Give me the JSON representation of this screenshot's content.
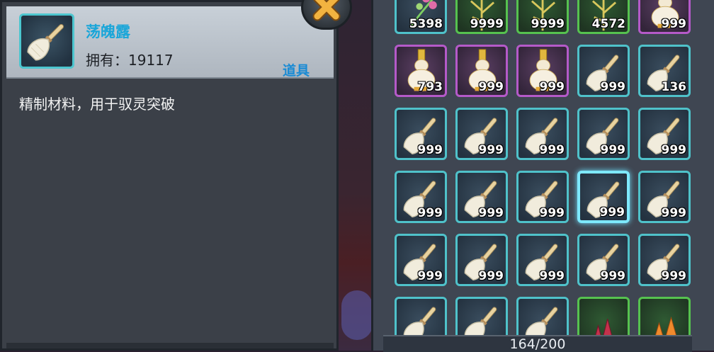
{
  "detail": {
    "name": "荡魄露",
    "owned_label": "拥有：",
    "owned_count": "19117",
    "type": "道具",
    "description": "精制材料，用于驭灵突破"
  },
  "bag": {
    "capacity": "164/200",
    "rows": [
      [
        {
          "kind": "herb-pink",
          "rarity": "teal",
          "qty": "5398"
        },
        {
          "kind": "herb-gold",
          "rarity": "green",
          "qty": "9999"
        },
        {
          "kind": "herb-gold",
          "rarity": "green",
          "qty": "9999"
        },
        {
          "kind": "herb-gold",
          "rarity": "green",
          "qty": "4572"
        },
        {
          "kind": "gourd-vase",
          "rarity": "purple",
          "qty": "999"
        }
      ],
      [
        {
          "kind": "gourd-vase",
          "rarity": "purple",
          "qty": "793"
        },
        {
          "kind": "gourd-vase",
          "rarity": "purple",
          "qty": "999"
        },
        {
          "kind": "gourd-vase",
          "rarity": "purple",
          "qty": "999"
        },
        {
          "kind": "spirit-bottle",
          "rarity": "teal",
          "qty": "999"
        },
        {
          "kind": "spirit-bottle",
          "rarity": "teal",
          "qty": "136"
        }
      ],
      [
        {
          "kind": "spirit-bottle",
          "rarity": "teal",
          "qty": "999"
        },
        {
          "kind": "spirit-bottle",
          "rarity": "teal",
          "qty": "999"
        },
        {
          "kind": "spirit-bottle",
          "rarity": "teal",
          "qty": "999"
        },
        {
          "kind": "spirit-bottle",
          "rarity": "teal",
          "qty": "999"
        },
        {
          "kind": "spirit-bottle",
          "rarity": "teal",
          "qty": "999"
        }
      ],
      [
        {
          "kind": "spirit-bottle",
          "rarity": "teal",
          "qty": "999"
        },
        {
          "kind": "spirit-bottle",
          "rarity": "teal",
          "qty": "999"
        },
        {
          "kind": "spirit-bottle",
          "rarity": "teal",
          "qty": "999"
        },
        {
          "kind": "spirit-bottle",
          "rarity": "teal",
          "qty": "999",
          "selected": true
        },
        {
          "kind": "spirit-bottle",
          "rarity": "teal",
          "qty": "999"
        }
      ],
      [
        {
          "kind": "spirit-bottle",
          "rarity": "teal",
          "qty": "999"
        },
        {
          "kind": "spirit-bottle",
          "rarity": "teal",
          "qty": "999"
        },
        {
          "kind": "spirit-bottle",
          "rarity": "teal",
          "qty": "999"
        },
        {
          "kind": "spirit-bottle",
          "rarity": "teal",
          "qty": "999"
        },
        {
          "kind": "spirit-bottle",
          "rarity": "teal",
          "qty": "999"
        }
      ],
      [
        {
          "kind": "spirit-bottle",
          "rarity": "teal",
          "qty": ""
        },
        {
          "kind": "spirit-bottle",
          "rarity": "teal",
          "qty": ""
        },
        {
          "kind": "spirit-bottle",
          "rarity": "teal",
          "qty": ""
        },
        {
          "kind": "crystal-red",
          "rarity": "green",
          "qty": ""
        },
        {
          "kind": "crystal-orange",
          "rarity": "green",
          "qty": ""
        }
      ]
    ]
  },
  "colors": {
    "rarity_teal": "#4fc2ca",
    "rarity_purple": "#b55ac9",
    "rarity_green": "#56c24f",
    "item_name": "#1aa6d9",
    "item_type": "#1a8bd4",
    "close_x": "#f2b340"
  }
}
